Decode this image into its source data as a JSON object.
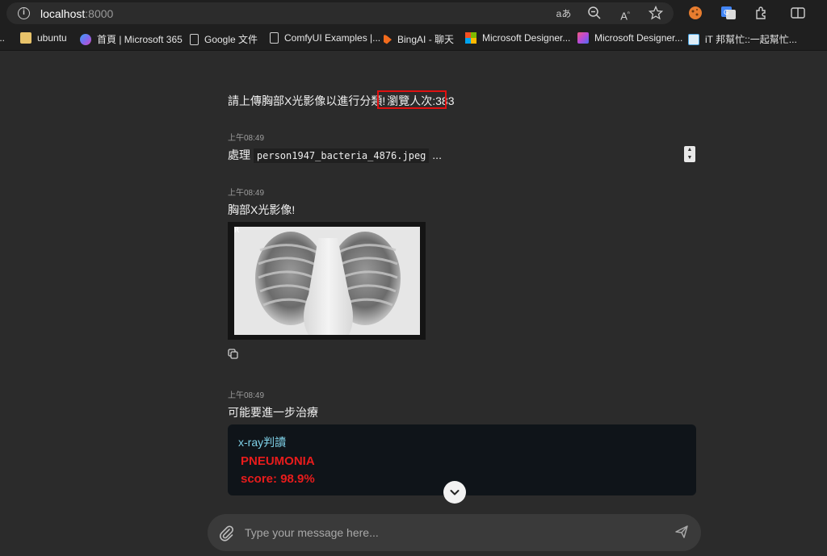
{
  "browser": {
    "url_host": "localhost",
    "url_port": ":8000",
    "tools": [
      "translate-icon",
      "zoom-out-icon",
      "read-aloud-icon",
      "favorite-icon"
    ]
  },
  "bookmarks": [
    {
      "label": "...",
      "icon": "bookmark-partial-icon",
      "color": "#e8c36a"
    },
    {
      "label": "ubuntu",
      "icon": "folder-icon",
      "color": "#e8c36a"
    },
    {
      "label": "首頁 | Microsoft 365",
      "icon": "microsoft365-icon",
      "color": "#7a6cf0"
    },
    {
      "label": "Google 文件",
      "icon": "document-icon",
      "color": "#cfcfcf"
    },
    {
      "label": "ComfyUI Examples |...",
      "icon": "document-icon",
      "color": "#cfcfcf"
    },
    {
      "label": "BingAI - 聊天",
      "icon": "bing-icon",
      "color": "#f26b1d"
    },
    {
      "label": "Microsoft Designer...",
      "icon": "microsoft-icon",
      "color": "#f25022"
    },
    {
      "label": "Microsoft Designer...",
      "icon": "designer-icon",
      "color": "#b84bd8"
    },
    {
      "label": "iT 邦幫忙::一起幫忙...",
      "icon": "ithome-icon",
      "color": "#4aa3df"
    }
  ],
  "chat": {
    "intro_text": "請上傳胸部X光影像以進行分類!",
    "visitor_count": "瀏覽人次:383",
    "messages": [
      {
        "time": "上午08:49",
        "prefix": "處理",
        "filename": "person1947_bacteria_4876.jpeg",
        "suffix": "..."
      },
      {
        "time": "上午08:49",
        "text": "胸部X光影像!"
      },
      {
        "time": "上午08:49",
        "text": "可能要進一步治療"
      }
    ],
    "result": {
      "title": "x-ray判讀",
      "label": "PNEUMONIA",
      "score": "score: 98.9%"
    }
  },
  "composer": {
    "placeholder": "Type your message here..."
  },
  "colors": {
    "background": "#2b2b2b",
    "highlight_box": "#e01010",
    "diagnosis": "#e81c1c",
    "card_title": "#7fd1e8"
  }
}
